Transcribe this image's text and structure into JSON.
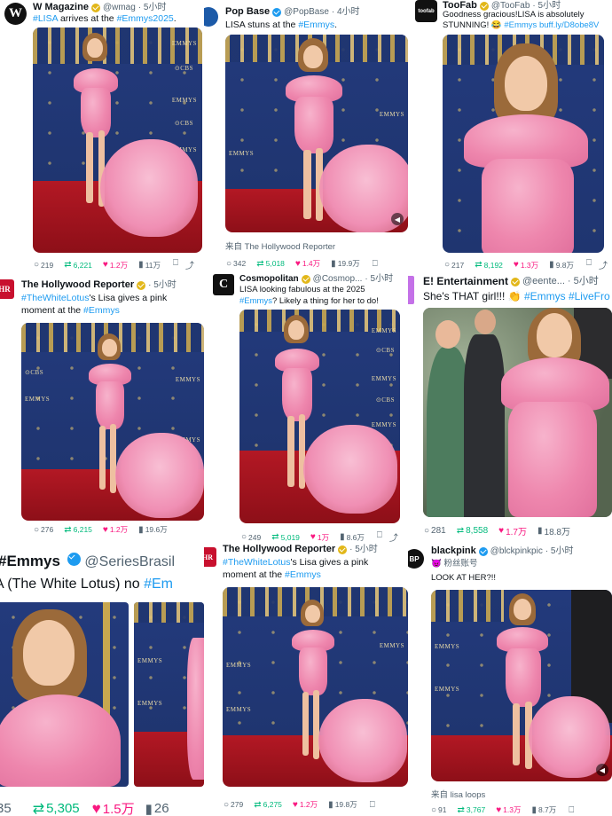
{
  "posts": [
    {
      "name": "W Magazine",
      "handle": "@wmag",
      "time": "· 5小时",
      "avatar_letter": "W",
      "text_tag1": "#LISA",
      "text_mid": " arrives at the ",
      "text_tag2": "#Emmys2025",
      "text_end": ".",
      "replies": "219",
      "reposts": "6,221",
      "likes": "1.2万",
      "views": "11万"
    },
    {
      "name": "Pop Base",
      "handle": "@PopBase",
      "time": "· 4小时",
      "text_plain": "LISA stuns at the ",
      "text_tag": "#Emmys",
      "text_end": ".",
      "source": "来自 The Hollywood Reporter",
      "replies": "342",
      "reposts": "5,018",
      "likes": "1.4万",
      "views": "19.9万"
    },
    {
      "name": "TooFab",
      "handle": "@TooFab",
      "time": "· 5小时",
      "avatar_text": "toofab",
      "text_line1": "Goodness gracious!LISA is absolutely",
      "text_line2_plain": "STUNNING! 😂 ",
      "text_line2_tag": "#Emmys",
      "text_line2_link": " buff.ly/D8obe8V",
      "replies": "217",
      "reposts": "8,192",
      "likes": "1.3万",
      "views": "9.8万"
    },
    {
      "name": "The Hollywood Reporter",
      "time": "· 5小时",
      "avatar_text": "HR",
      "text_tag": "#TheWhiteLotus",
      "text_line1_end": "'s Lisa gives a pink",
      "text_line2_plain": "moment at the ",
      "text_line2_tag": "#Emmys",
      "replies": "276",
      "reposts": "6,215",
      "likes": "1.2万",
      "views": "19.6万"
    },
    {
      "name": "Cosmopolitan",
      "handle": "@Cosmop...",
      "time": "· 5小时",
      "avatar_text": "C",
      "text_line1": "LISA looking fabulous at the 2025",
      "text_line2_tag": "#Emmys",
      "text_line2_end": "? Likely a thing for her to do!",
      "replies": "249",
      "reposts": "5,019",
      "likes": "1万",
      "views": "8.6万"
    },
    {
      "name": "E! Entertainment",
      "handle": "@eente...",
      "time": "· 5小时",
      "text_plain": "She's THAT girl!!! 👏 ",
      "text_tag1": "#Emmys",
      "text_tag2": " #LiveFro",
      "replies": "281",
      "reposts": "8,558",
      "likes": "1.7万",
      "views": "18.8万"
    },
    {
      "name_tag": "#Emmys",
      "handle": "@SeriesBrasil",
      "text_plain": "A (The White Lotus) no ",
      "text_tag": "#Em",
      "replies": "35",
      "reposts": "5,305",
      "likes": "1.5万",
      "views": "26"
    },
    {
      "name": "The Hollywood Reporter",
      "time": "· 5小时",
      "avatar_text": "HR",
      "text_tag": "#TheWhiteLotus",
      "text_line1_end": "'s Lisa gives a pink",
      "text_line2_plain": "moment at the ",
      "text_line2_tag": "#Emmys",
      "replies": "279",
      "reposts": "6,275",
      "likes": "1.2万",
      "views": "19.8万"
    },
    {
      "name": "blackpink",
      "handle": "@blckpinkpic",
      "time": "· 5小时",
      "avatar_text": "BP",
      "subtitle": "😈 粉丝账号",
      "text": "LOOK AT HER?!!",
      "source": "来自 lisa loops",
      "replies": "91",
      "reposts": "3,767",
      "likes": "1.3万",
      "views": "8.7万"
    }
  ],
  "photo_label": "EMMYS",
  "photo_label_cbs": "⊙CBS",
  "icons": {
    "reply": "comment-icon",
    "repost": "repost-icon",
    "like": "heart-icon",
    "views": "views-icon",
    "bookmark": "bookmark-icon",
    "share": "share-icon"
  },
  "colors": {
    "link": "#1d9bf0",
    "repost": "#00ba7c",
    "like": "#f91880",
    "carpet": "#b31824",
    "backdrop": "#1f3570",
    "gown": "#ee86ad"
  }
}
